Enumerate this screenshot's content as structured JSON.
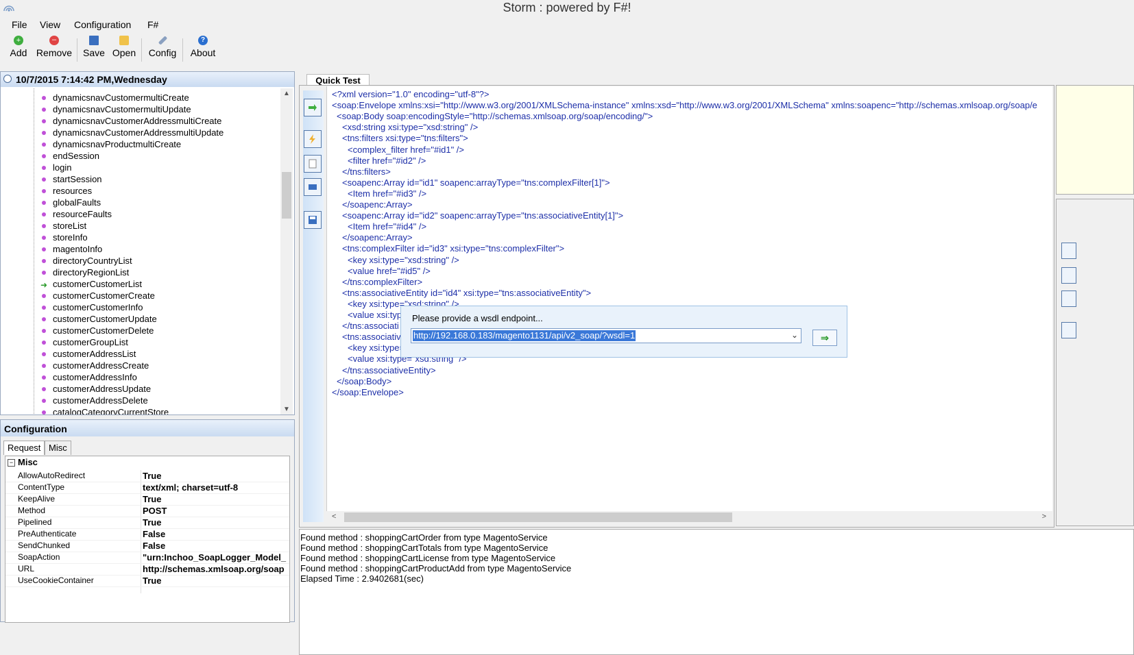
{
  "window": {
    "title": "Storm : powered by F#!"
  },
  "menu": [
    {
      "label": "File"
    },
    {
      "label": "View"
    },
    {
      "label": "Configuration"
    },
    {
      "label": "F#"
    }
  ],
  "toolbar": {
    "add": "Add",
    "remove": "Remove",
    "save": "Save",
    "open": "Open",
    "config": "Config",
    "about": "About"
  },
  "tree": {
    "header": "10/7/2015 7:14:42 PM,Wednesday",
    "items": [
      "dynamicsnavCustomermultiCreate",
      "dynamicsnavCustomermultiUpdate",
      "dynamicsnavCustomerAddressmultiCreate",
      "dynamicsnavCustomerAddressmultiUpdate",
      "dynamicsnavProductmultiCreate",
      "endSession",
      "login",
      "startSession",
      "resources",
      "globalFaults",
      "resourceFaults",
      "storeList",
      "storeInfo",
      "magentoInfo",
      "directoryCountryList",
      "directoryRegionList",
      "customerCustomerList",
      "customerCustomerCreate",
      "customerCustomerInfo",
      "customerCustomerUpdate",
      "customerCustomerDelete",
      "customerGroupList",
      "customerAddressList",
      "customerAddressCreate",
      "customerAddressInfo",
      "customerAddressUpdate",
      "customerAddressDelete",
      "catalogCategoryCurrentStore"
    ],
    "selected_index": 16
  },
  "config": {
    "header": "Configuration",
    "tabs": [
      "Request",
      "Misc"
    ],
    "group": "Misc",
    "rows": [
      {
        "key": "AllowAutoRedirect",
        "value": "True"
      },
      {
        "key": "ContentType",
        "value": "text/xml; charset=utf-8"
      },
      {
        "key": "KeepAlive",
        "value": "True"
      },
      {
        "key": "Method",
        "value": "POST"
      },
      {
        "key": "Pipelined",
        "value": "True"
      },
      {
        "key": "PreAuthenticate",
        "value": "False"
      },
      {
        "key": "SendChunked",
        "value": "False"
      },
      {
        "key": "SoapAction",
        "value": "\"urn:Inchoo_SoapLogger_Model_"
      },
      {
        "key": "URL",
        "value": "http://schemas.xmlsoap.org/soap"
      },
      {
        "key": "UseCookieContainer",
        "value": "True"
      }
    ]
  },
  "quicktest": {
    "tab": "Quick Test",
    "xml_lines": [
      "<?xml version=\"1.0\" encoding=\"utf-8\"?>",
      "<soap:Envelope xmlns:xsi=\"http://www.w3.org/2001/XMLSchema-instance\" xmlns:xsd=\"http://www.w3.org/2001/XMLSchema\" xmlns:soapenc=\"http://schemas.xmlsoap.org/soap/e",
      "<soap:Body soap:encodingStyle=\"http://schemas.xmlsoap.org/soap/encoding/\">",
      "<xsd:string xsi:type=\"xsd:string\" />",
      "<tns:filters xsi:type=\"tns:filters\">",
      "<complex_filter href=\"#id1\" />",
      "<filter href=\"#id2\" />",
      "</tns:filters>",
      "<soapenc:Array id=\"id1\" soapenc:arrayType=\"tns:complexFilter[1]\">",
      "<Item href=\"#id3\" />",
      "</soapenc:Array>",
      "<soapenc:Array id=\"id2\" soapenc:arrayType=\"tns:associativeEntity[1]\">",
      "<Item href=\"#id4\" />",
      "</soapenc:Array>",
      "<tns:complexFilter id=\"id3\" xsi:type=\"tns:complexFilter\">",
      "<key xsi:type=\"xsd:string\" />",
      "<value href=\"#id5\" />",
      "</tns:complexFilter>",
      "<tns:associativeEntity id=\"id4\" xsi:type=\"tns:associativeEntity\">",
      "<key xsi:type=\"xsd:string\" />",
      "<value xsi:typ",
      "</tns:associati",
      "<tns:associativ",
      "<key xsi:type=",
      "<value xsi:type=\"xsd:string\" />",
      "</tns:associativeEntity>",
      "</soap:Body>",
      "</soap:Envelope>"
    ]
  },
  "dialog": {
    "label": "Please provide a wsdl endpoint...",
    "value": "http://192.168.0.183/magento1131/api/v2_soap/?wsdl=1",
    "go": "⇒"
  },
  "log": {
    "lines": [
      "Found method : shoppingCartOrder from type MagentoService",
      "Found method : shoppingCartTotals from type MagentoService",
      "Found method : shoppingCartLicense from type MagentoService",
      "Found method : shoppingCartProductAdd from type MagentoService",
      "Elapsed Time : 2.9402681(sec)"
    ]
  },
  "icons": {
    "add": "plus-circle-icon",
    "remove": "minus-circle-icon",
    "save": "floppy-icon",
    "open": "folder-icon",
    "config": "wrench-icon",
    "about": "info-icon"
  },
  "colors": {
    "accent": "#c9dbf1",
    "xml_tag": "#1d2fa8",
    "xml_attr": "#d00000",
    "tree_bullet": "#c050d8",
    "selected_arrow": "#2a9a2a"
  }
}
